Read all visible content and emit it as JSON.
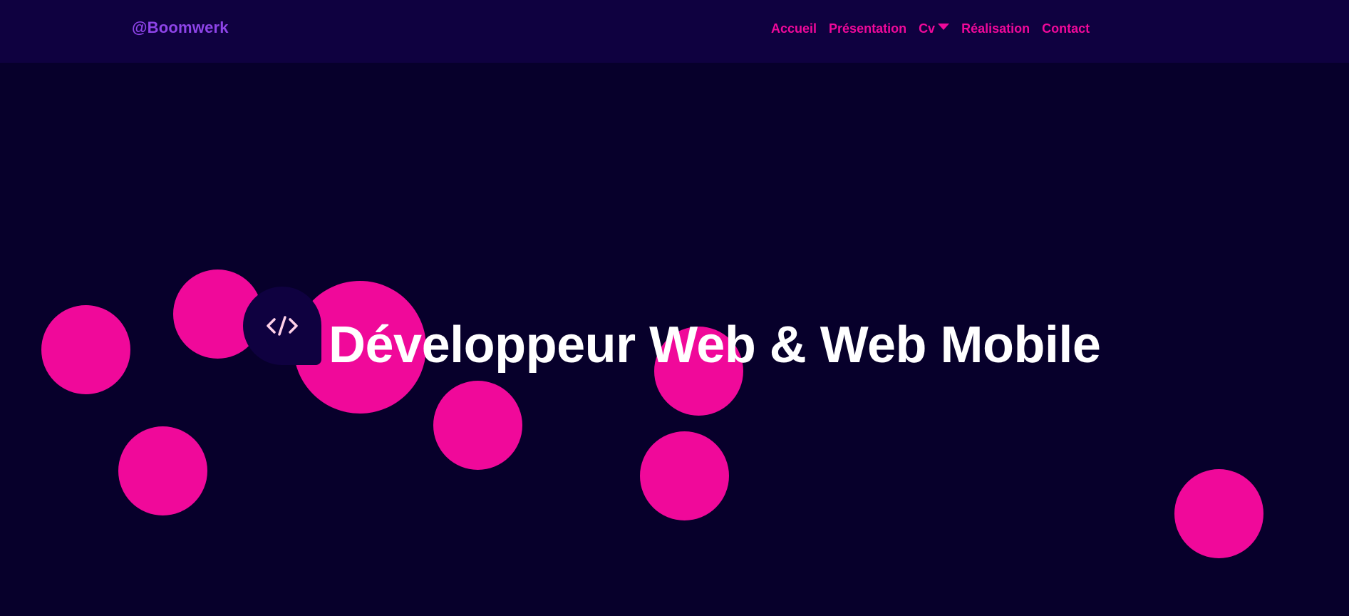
{
  "brand": {
    "label": "@Boomwerk"
  },
  "nav": {
    "items": [
      {
        "label": "Accueil"
      },
      {
        "label": "Présentation"
      },
      {
        "label": "Cv"
      },
      {
        "label": "Réalisation"
      },
      {
        "label": "Contact"
      }
    ]
  },
  "hero": {
    "title": "Développeur Web & Web Mobile",
    "icon": "code-brackets-icon"
  },
  "colors": {
    "background": "#07002b",
    "navbar": "#0f0140",
    "accent_pink": "#f0099a",
    "brand_purple": "#8e44e8",
    "title": "#ffffff"
  }
}
